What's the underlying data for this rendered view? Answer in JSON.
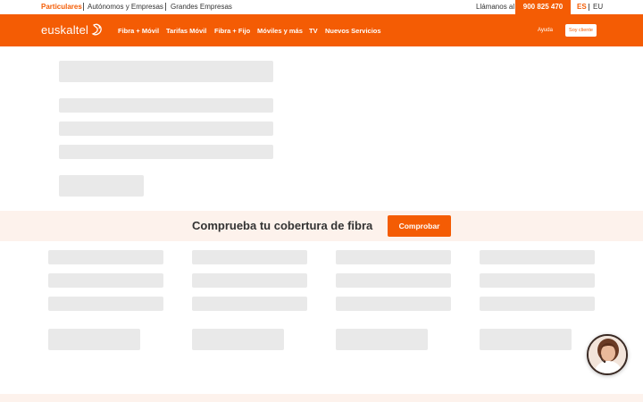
{
  "topbar": {
    "segments": [
      "Particulares",
      "Autónomos y Empresas",
      "Grandes Empresas"
    ],
    "call_label": "Llámanos al",
    "phone": "900 825 470",
    "lang_es": "ES",
    "lang_eu": "EU"
  },
  "nav": {
    "logo": "euskaltel",
    "items": [
      "Fibra + Móvil",
      "Tarifas Móvil",
      "Fibra + Fijo",
      "Móviles y más",
      "TV",
      "Nuevos Servicios"
    ],
    "help": "Ayuda",
    "client": "Soy cliente"
  },
  "coverage": {
    "title": "Comprueba tu cobertura de fibra",
    "button": "Comprobar"
  },
  "colors": {
    "brand": "#f45c04",
    "skeleton": "#e9e9e9",
    "band": "#fdf2ec"
  },
  "icons": [
    "euskaltel-logo-icon",
    "chat-assistant-icon"
  ]
}
